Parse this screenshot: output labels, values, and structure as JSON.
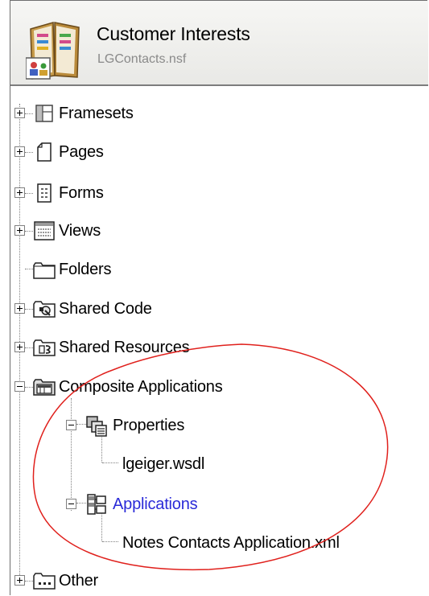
{
  "database": {
    "title": "Customer Interests",
    "filename": "LGContacts.nsf"
  },
  "tree": {
    "framesets": "Framesets",
    "pages": "Pages",
    "forms": "Forms",
    "views": "Views",
    "folders": "Folders",
    "shared_code": "Shared Code",
    "shared_resources": "Shared Resources",
    "composite_applications": "Composite Applications",
    "properties": "Properties",
    "properties_child": "lgeiger.wsdl",
    "applications": "Applications",
    "applications_child": "Notes Contacts Application.xml",
    "other": "Other"
  },
  "colors": {
    "link_text": "#2a2ad8",
    "annotation_circle": "#e0201c",
    "header_border": "#7d7d7d"
  },
  "icons": {
    "database": "notes-database-icon",
    "framesets": "frameset-icon",
    "pages": "page-icon",
    "forms": "form-icon",
    "views": "view-icon",
    "folders": "folder-icon",
    "shared_code": "shared-code-folder-icon",
    "shared_resources": "shared-resources-folder-icon",
    "composite_applications": "composite-applications-folder-icon",
    "properties": "properties-icon",
    "applications": "applications-icon",
    "other": "other-folder-icon"
  }
}
